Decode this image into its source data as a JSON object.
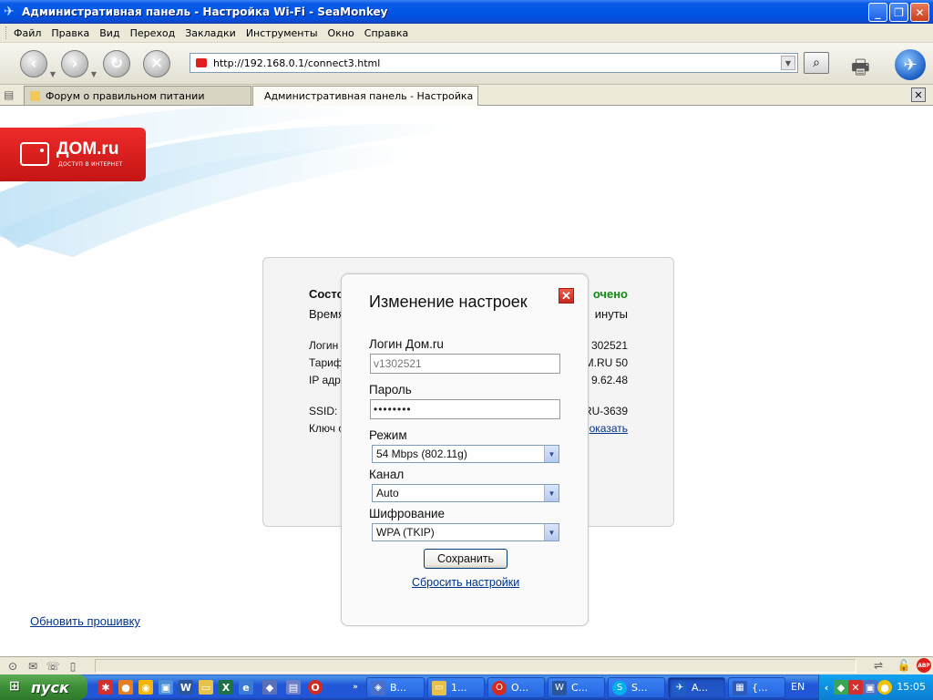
{
  "window": {
    "title": "Административная панель - Настройка Wi-Fi - SeaMonkey",
    "minimize": "_",
    "maximize": "❐",
    "close": "✕"
  },
  "menu": [
    "Файл",
    "Правка",
    "Вид",
    "Переход",
    "Закладки",
    "Инструменты",
    "Окно",
    "Справка"
  ],
  "address_bar": {
    "url": "http://192.168.0.1/connect3.html"
  },
  "tabs": [
    {
      "label": "Форум о правильном питании"
    },
    {
      "label": "Административная панель - Настройка ..."
    }
  ],
  "logo": {
    "name": "ДОМ.ru",
    "tagline": "ДОСТУП В ИНТЕРНЕТ"
  },
  "panel": {
    "status_label": "Состо",
    "status_value": "очено",
    "time_label": "Время",
    "time_value": "инуты",
    "login_label": "Логин",
    "login_value": "302521",
    "tariff_label": "Тариф",
    "tariff_value": "M.RU 50",
    "ip_label": "IP адр",
    "ip_value": "9.62.48",
    "ssid_label": "SSID:",
    "ssid_value": "RU-3639",
    "key_label": "Ключ с",
    "key_value": "оказать"
  },
  "firmware_link": "Обновить прошивку",
  "modal": {
    "title": "Изменение настроек",
    "close": "✕",
    "login_label": "Логин Дом.ru",
    "login_value": "v1302521",
    "password_label": "Пароль",
    "password_value": "••••••••",
    "mode_label": "Режим",
    "mode_value": "54 Mbps (802.11g)",
    "channel_label": "Канал",
    "channel_value": "Auto",
    "encryption_label": "Шифрование",
    "encryption_value": "WPA (TKIP)",
    "save_label": "Сохранить",
    "reset_label": "Сбросить настройки"
  },
  "statusbar": {
    "abp": "ABP"
  },
  "taskbar": {
    "start": "пуск",
    "buttons": [
      {
        "label": "В..."
      },
      {
        "label": "1..."
      },
      {
        "label": "О..."
      },
      {
        "label": "С..."
      },
      {
        "label": "S..."
      },
      {
        "label": "А..."
      },
      {
        "label": "{..."
      }
    ],
    "language": "EN",
    "clock": "15:05"
  },
  "colors": {
    "accent_red": "#e52421",
    "link_blue": "#00338c",
    "status_green": "#118b11"
  }
}
